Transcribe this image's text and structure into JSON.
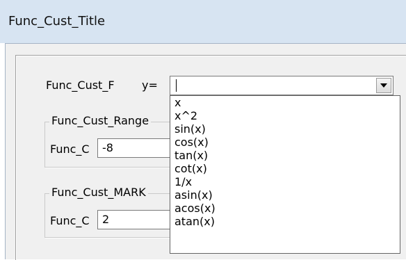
{
  "window": {
    "title": "Func_Cust_Title"
  },
  "function_row": {
    "label": "Func_Cust_F",
    "y_label": "y=",
    "value": ""
  },
  "range_group": {
    "legend": "Func_Cust_Range",
    "field_label": "Func_C",
    "field_value": "-8"
  },
  "mark_group": {
    "legend": "Func_Cust_MARK",
    "field_label": "Func_C",
    "field_value": "2"
  },
  "dropdown": {
    "options": [
      "x",
      "x^2",
      "sin(x)",
      "cos(x)",
      "tan(x)",
      "cot(x)",
      "1/x",
      "asin(x)",
      "acos(x)",
      "atan(x)"
    ]
  },
  "icons": {
    "dropdown_arrow": "chevron-down-icon"
  },
  "colors": {
    "titlebar_bg": "#d7e4f2",
    "dialog_bg": "#f0f0f0",
    "list_bg": "#ffffff"
  }
}
